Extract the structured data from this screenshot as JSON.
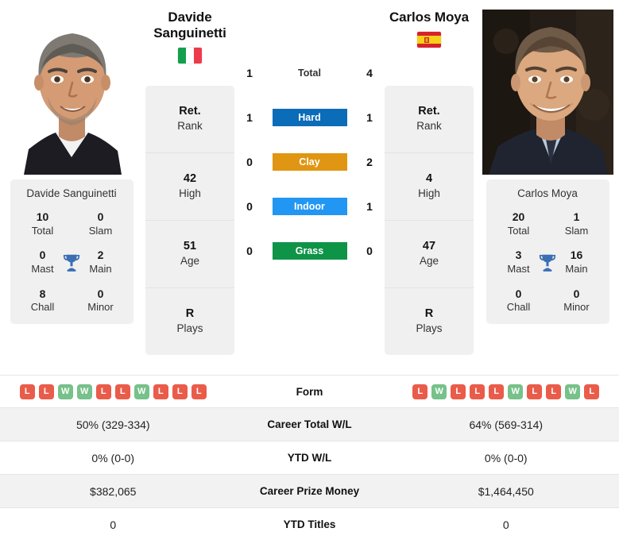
{
  "players": {
    "left": {
      "name_line1": "Davide",
      "name_line2": "Sanguinetti",
      "full_name": "Davide Sanguinetti",
      "country": "Italy",
      "flag": "it-flag",
      "photo_alt": "Davide Sanguinetti headshot",
      "stats": [
        {
          "value": "Ret.",
          "label": "Rank"
        },
        {
          "value": "42",
          "label": "High"
        },
        {
          "value": "51",
          "label": "Age"
        },
        {
          "value": "R",
          "label": "Plays"
        }
      ],
      "titles": [
        {
          "value": "10",
          "label": "Total"
        },
        {
          "value": "0",
          "label": "Slam"
        },
        {
          "value": "0",
          "label": "Mast"
        },
        {
          "value": "2",
          "label": "Main"
        },
        {
          "value": "8",
          "label": "Chall"
        },
        {
          "value": "0",
          "label": "Minor"
        }
      ],
      "form": [
        "L",
        "L",
        "W",
        "W",
        "L",
        "L",
        "W",
        "L",
        "L",
        "L"
      ],
      "career_total_wl": "50% (329-334)",
      "ytd_wl": "0% (0-0)",
      "career_prize_money": "$382,065",
      "ytd_titles": "0"
    },
    "right": {
      "name_line1": "Carlos Moya",
      "name_line2": "",
      "full_name": "Carlos Moya",
      "country": "Spain",
      "flag": "es-flag",
      "photo_alt": "Carlos Moya portrait",
      "stats": [
        {
          "value": "Ret.",
          "label": "Rank"
        },
        {
          "value": "4",
          "label": "High"
        },
        {
          "value": "47",
          "label": "Age"
        },
        {
          "value": "R",
          "label": "Plays"
        }
      ],
      "titles": [
        {
          "value": "20",
          "label": "Total"
        },
        {
          "value": "1",
          "label": "Slam"
        },
        {
          "value": "3",
          "label": "Mast"
        },
        {
          "value": "16",
          "label": "Main"
        },
        {
          "value": "0",
          "label": "Chall"
        },
        {
          "value": "0",
          "label": "Minor"
        }
      ],
      "form": [
        "L",
        "W",
        "L",
        "L",
        "L",
        "W",
        "L",
        "L",
        "W",
        "L"
      ],
      "career_total_wl": "64% (569-314)",
      "ytd_wl": "0% (0-0)",
      "career_prize_money": "$1,464,450",
      "ytd_titles": "0"
    }
  },
  "head_to_head": [
    {
      "label": "Total",
      "left": "1",
      "right": "4",
      "color": "",
      "style": "plain"
    },
    {
      "label": "Hard",
      "left": "1",
      "right": "1",
      "color": "#0b6cb8",
      "style": "badge"
    },
    {
      "label": "Clay",
      "left": "0",
      "right": "2",
      "color": "#e09612",
      "style": "badge"
    },
    {
      "label": "Indoor",
      "left": "0",
      "right": "1",
      "color": "#2196f3",
      "style": "badge"
    },
    {
      "label": "Grass",
      "left": "0",
      "right": "0",
      "color": "#0e9447",
      "style": "badge"
    }
  ],
  "table_rows": [
    {
      "label": "Form",
      "left": "",
      "right": "",
      "kind": "form"
    },
    {
      "label": "Career Total W/L",
      "left": "50% (329-334)",
      "right": "64% (569-314)",
      "kind": "text"
    },
    {
      "label": "YTD W/L",
      "left": "0% (0-0)",
      "right": "0% (0-0)",
      "kind": "text"
    },
    {
      "label": "Career Prize Money",
      "left": "$382,065",
      "right": "$1,464,450",
      "kind": "text"
    },
    {
      "label": "YTD Titles",
      "left": "0",
      "right": "0",
      "kind": "text"
    }
  ],
  "colors": {
    "hard": "#0b6cb8",
    "clay": "#e09612",
    "indoor": "#2196f3",
    "grass": "#0e9447",
    "win": "#77c18a",
    "loss": "#ea5c4a",
    "trophy": "#3c6eb4",
    "card_bg": "#f0f0f0",
    "row_alt_bg": "#f2f2f2"
  }
}
